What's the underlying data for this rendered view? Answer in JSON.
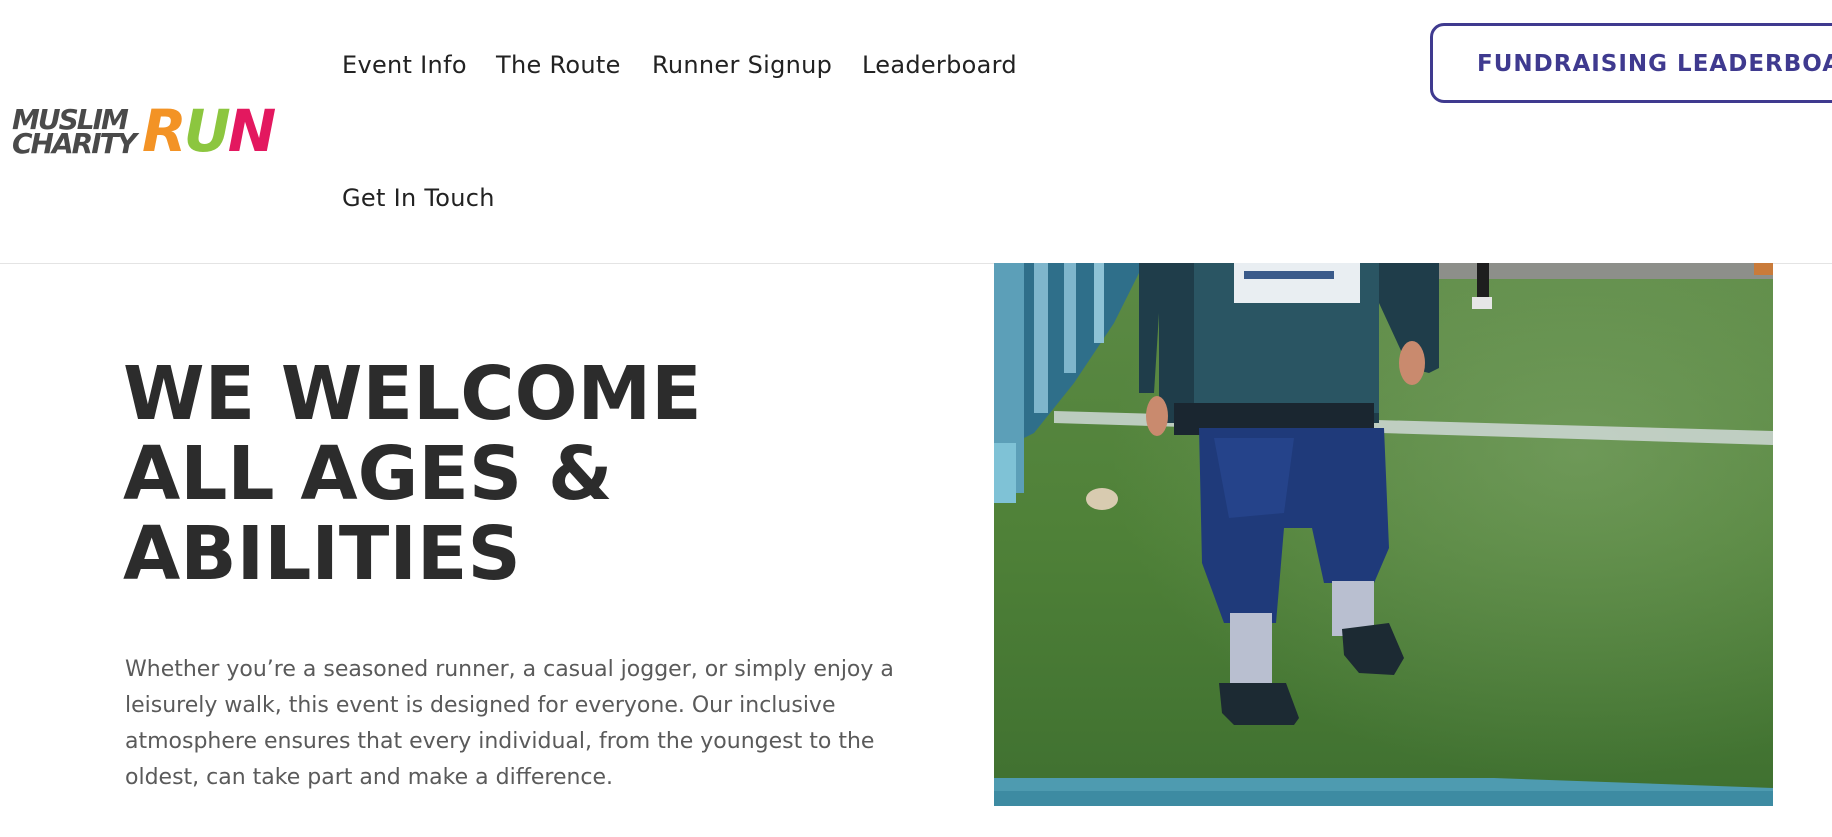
{
  "logo": {
    "top_word": "MUSLIM",
    "bottom_word": "CHARITY",
    "run_letters": [
      {
        "char": "R",
        "color": "#f39325"
      },
      {
        "char": "U",
        "color": "#8cc63f"
      },
      {
        "char": "N",
        "color": "#e3185f"
      }
    ]
  },
  "nav": {
    "items": [
      {
        "label": "Event Info"
      },
      {
        "label": "The Route"
      },
      {
        "label": "Runner Signup"
      },
      {
        "label": "Leaderboard"
      },
      {
        "label": "Get In Touch"
      }
    ]
  },
  "header": {
    "cta_label": "FUNDRAISING LEADERBOARD"
  },
  "hero": {
    "heading_lines": [
      "WE WELCOME",
      "ALL AGES &",
      "ABILITIES"
    ],
    "paragraph": "Whether you’re a seasoned runner, a casual jogger, or simply enjoy a leisurely walk, this event is designed for everyone. Our inclusive atmosphere ensures that every individual, from the youngest to the oldest, can take part and make a difference."
  },
  "colors": {
    "brand_purple": "#3f3a8f",
    "heading": "#2c2c2c",
    "body_text": "#5a5a5a"
  }
}
